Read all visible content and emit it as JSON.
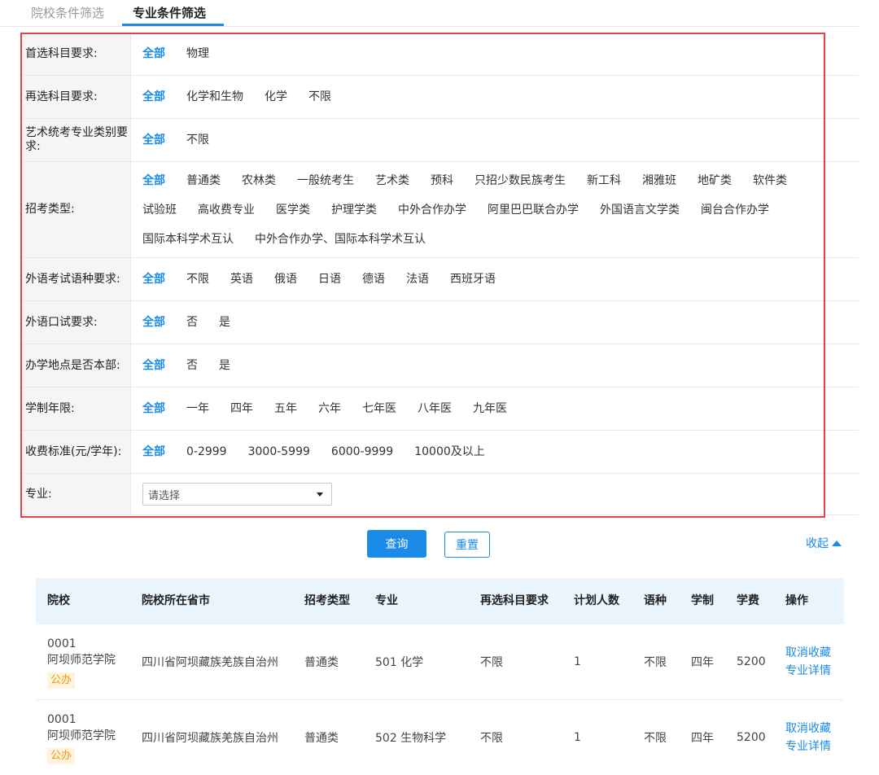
{
  "tabs": [
    "院校条件筛选",
    "专业条件筛选"
  ],
  "filters": [
    {
      "label": "首选科目要求:",
      "options": [
        "全部",
        "物理"
      ]
    },
    {
      "label": "再选科目要求:",
      "options": [
        "全部",
        "化学和生物",
        "化学",
        "不限"
      ]
    },
    {
      "label": "艺术统考专业类别要求:",
      "options": [
        "全部",
        "不限"
      ]
    },
    {
      "label": "招考类型:",
      "options": [
        "全部",
        "普通类",
        "农林类",
        "一般统考生",
        "艺术类",
        "预科",
        "只招少数民族考生",
        "新工科",
        "湘雅班",
        "地矿类",
        "软件类",
        "试验班",
        "高收费专业",
        "医学类",
        "护理学类",
        "中外合作办学",
        "阿里巴巴联合办学",
        "外国语言文学类",
        "闽台合作办学",
        "国际本科学术互认",
        "中外合作办学、国际本科学术互认"
      ]
    },
    {
      "label": "外语考试语种要求:",
      "options": [
        "全部",
        "不限",
        "英语",
        "俄语",
        "日语",
        "德语",
        "法语",
        "西班牙语"
      ]
    },
    {
      "label": "外语口试要求:",
      "options": [
        "全部",
        "否",
        "是"
      ]
    },
    {
      "label": "办学地点是否本部:",
      "options": [
        "全部",
        "否",
        "是"
      ]
    },
    {
      "label": "学制年限:",
      "options": [
        "全部",
        "一年",
        "四年",
        "五年",
        "六年",
        "七年医",
        "八年医",
        "九年医"
      ]
    },
    {
      "label": "收费标准(元/学年):",
      "options": [
        "全部",
        "0-2999",
        "3000-5999",
        "6000-9999",
        "10000及以上"
      ]
    }
  ],
  "major": {
    "label": "专业:",
    "placeholder": "请选择"
  },
  "actions": {
    "query": "查询",
    "reset": "重置",
    "collapse": "收起"
  },
  "table": {
    "headers": [
      "院校",
      "院校所在省市",
      "招考类型",
      "专业",
      "再选科目要求",
      "计划人数",
      "语种",
      "学制",
      "学费",
      "操作"
    ],
    "rows": [
      {
        "code": "0001",
        "school": "阿坝师范学院",
        "badge": "公办",
        "province": "四川省阿坝藏族羌族自治州",
        "type": "普通类",
        "major": "501 化学",
        "req": "不限",
        "plan": "1",
        "lang": "不限",
        "years": "四年",
        "fee": "5200",
        "op1": "取消收藏",
        "op2": "专业详情"
      },
      {
        "code": "0001",
        "school": "阿坝师范学院",
        "badge": "公办",
        "province": "四川省阿坝藏族羌族自治州",
        "type": "普通类",
        "major": "502 生物科学",
        "req": "不限",
        "plan": "1",
        "lang": "不限",
        "years": "四年",
        "fee": "5200",
        "op1": "取消收藏",
        "op2": "专业详情"
      }
    ]
  },
  "colors": {
    "accent": "#1a8be8",
    "highlight_border": "#e04545",
    "badge": "#f39800"
  }
}
